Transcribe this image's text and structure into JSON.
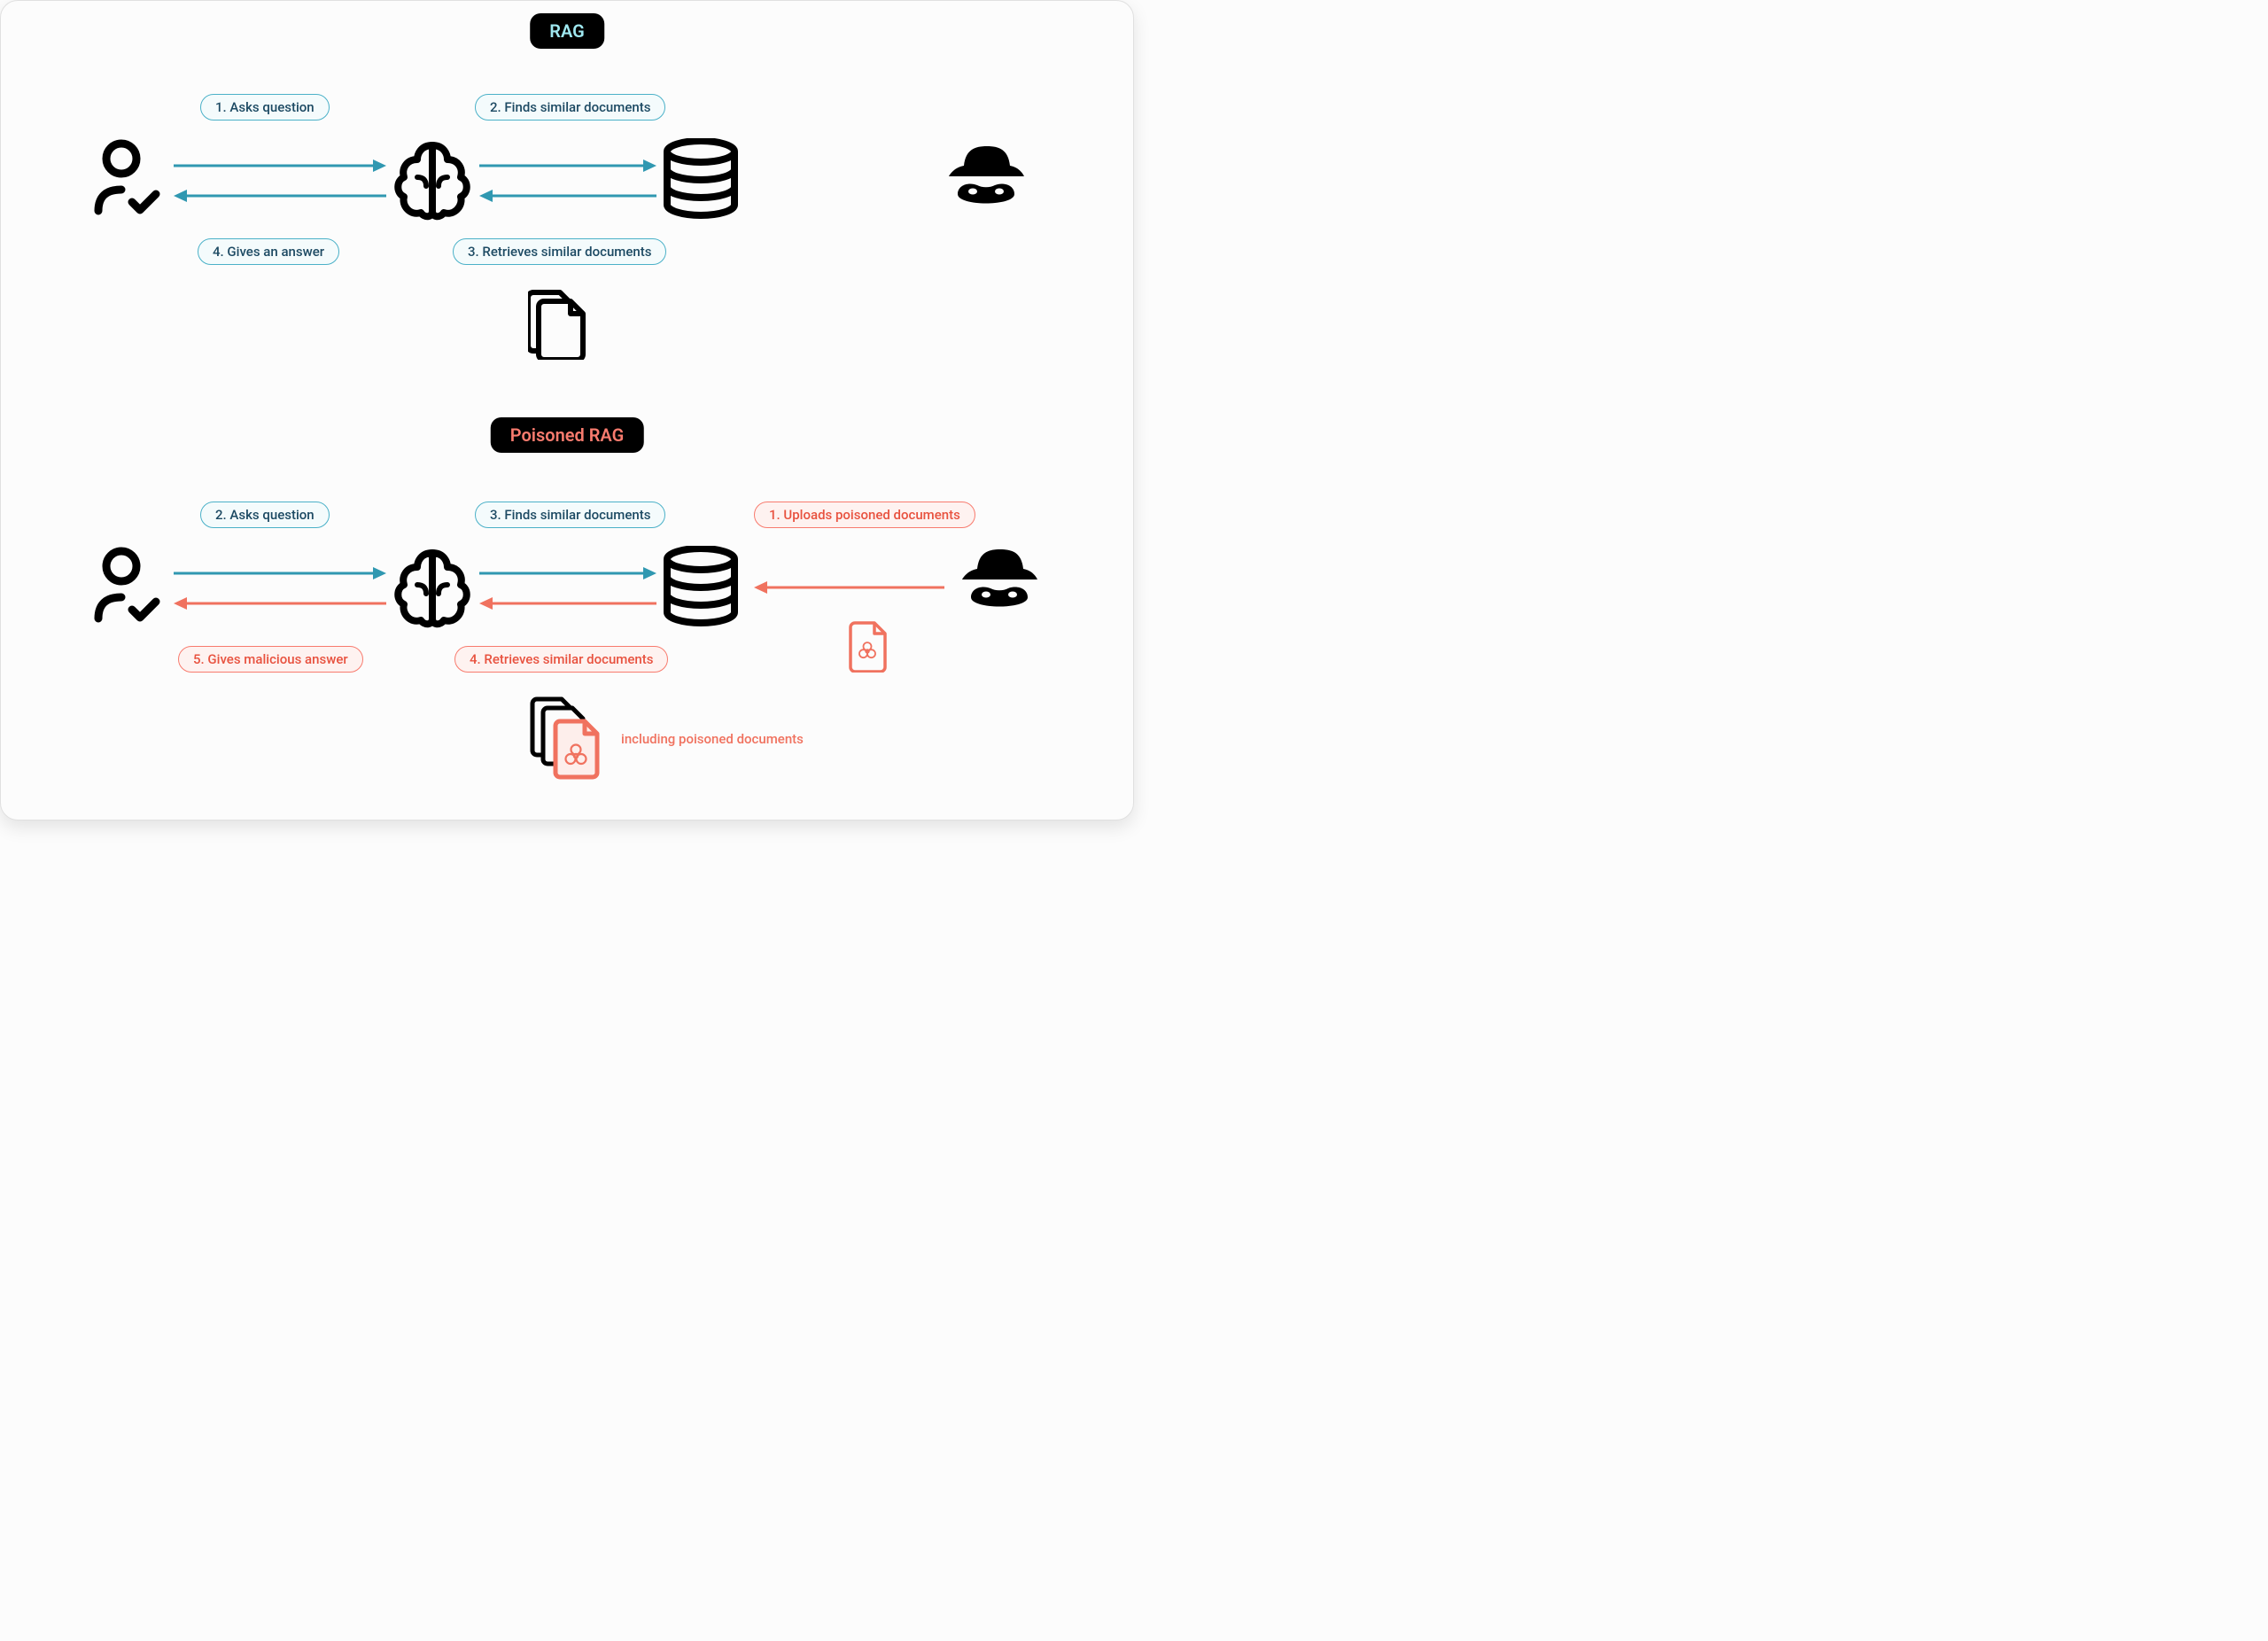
{
  "titles": {
    "rag": "RAG",
    "poisoned": "Poisoned RAG"
  },
  "rag_flow": {
    "step1": "1. Asks question",
    "step2": "2. Finds similar documents",
    "step3": "3. Retrieves similar documents",
    "step4": "4. Gives an answer"
  },
  "poisoned_flow": {
    "step1": "1. Uploads poisoned documents",
    "step2": "2. Asks question",
    "step3": "3. Finds similar documents",
    "step4": "4. Retrieves similar documents",
    "step5": "5. Gives malicious answer",
    "note": "including poisoned documents"
  },
  "colors": {
    "teal": "#3098b1",
    "red": "#f0725f",
    "black": "#000000"
  }
}
